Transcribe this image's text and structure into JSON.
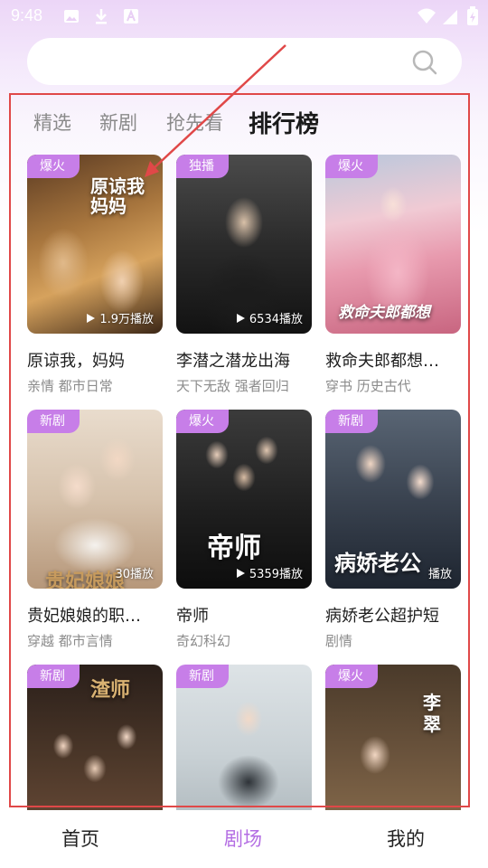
{
  "status_bar": {
    "time": "9:48",
    "icons_left": [
      "image-icon",
      "download-icon",
      "font-icon"
    ],
    "icons_right": [
      "wifi-icon",
      "signal-icon",
      "battery-charging-icon"
    ]
  },
  "search": {
    "placeholder": "",
    "icon": "search-icon"
  },
  "tabs": [
    {
      "label": "精选",
      "active": false
    },
    {
      "label": "新剧",
      "active": false
    },
    {
      "label": "抢先看",
      "active": false
    },
    {
      "label": "排行榜",
      "active": true
    }
  ],
  "cards": [
    {
      "badge": "爆火",
      "plays": "1.9万播放",
      "title": "原谅我，妈妈",
      "tags": "亲情 都市日常",
      "poster_text": "原谅我 妈妈"
    },
    {
      "badge": "独播",
      "plays": "6534播放",
      "title": "李潜之潜龙出海",
      "tags": "天下无敌 强者回归",
      "poster_text": ""
    },
    {
      "badge": "爆火",
      "plays": "",
      "title": "救命夫郎都想…",
      "tags": "穿书 历史古代",
      "poster_text": "救命夫郎都想"
    },
    {
      "badge": "新剧",
      "plays": "30播放",
      "title": "贵妃娘娘的职…",
      "tags": "穿越 都市言情",
      "poster_text": "贵妃娘娘"
    },
    {
      "badge": "爆火",
      "plays": "5359播放",
      "title": "帝师",
      "tags": "奇幻科幻",
      "poster_text": "帝师"
    },
    {
      "badge": "新剧",
      "plays": "播放",
      "title": "病娇老公超护短",
      "tags": "剧情",
      "poster_text": "病娇老公"
    },
    {
      "badge": "新剧",
      "plays": "",
      "title": "",
      "tags": "",
      "poster_text": "渣师"
    },
    {
      "badge": "新剧",
      "plays": "",
      "title": "",
      "tags": "",
      "poster_text": ""
    },
    {
      "badge": "爆火",
      "plays": "",
      "title": "",
      "tags": "",
      "poster_text": "李翠"
    }
  ],
  "bottom_nav": [
    {
      "label": "首页",
      "active": false
    },
    {
      "label": "剧场",
      "active": true
    },
    {
      "label": "我的",
      "active": false
    }
  ],
  "colors": {
    "accent": "#b36de3",
    "badge": "#c77ee8",
    "annotation": "#e04848"
  }
}
